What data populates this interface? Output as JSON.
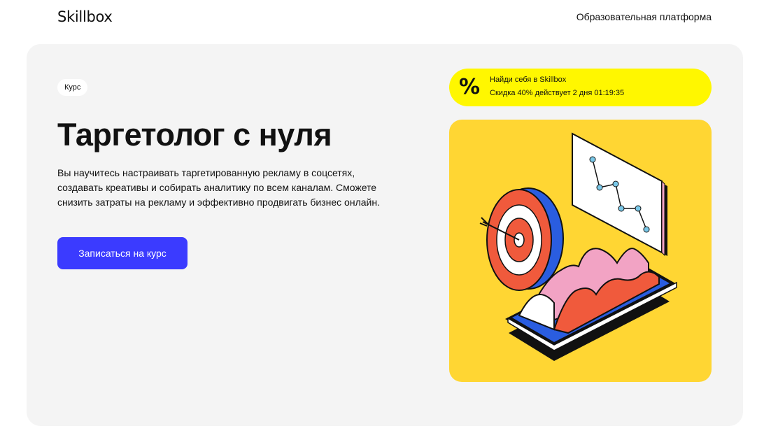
{
  "header": {
    "logo": "Skillbox",
    "link": "Образовательная платформа"
  },
  "hero": {
    "badge": "Курс",
    "title": "Таргетолог с нуля",
    "description": "Вы научитесь настраивать таргетированную рекламу в соцсетях, создавать креативы и собирать аналитику по всем каналам. Сможете снизить затраты на рекламу и эффективно продвигать бизнес онлайн.",
    "cta_label": "Записаться на курс"
  },
  "promo": {
    "icon": "percent-icon",
    "line1": "Найди себя в Skillbox",
    "line2": "Скидка 40% действует 2 дня 01:19:35"
  },
  "illustration": {
    "name": "targeting-illustration"
  },
  "colors": {
    "accent": "#3b3bff",
    "promo_bg": "#fff700",
    "illustration_bg": "#ffd633",
    "hero_bg": "#f4f4f4"
  }
}
